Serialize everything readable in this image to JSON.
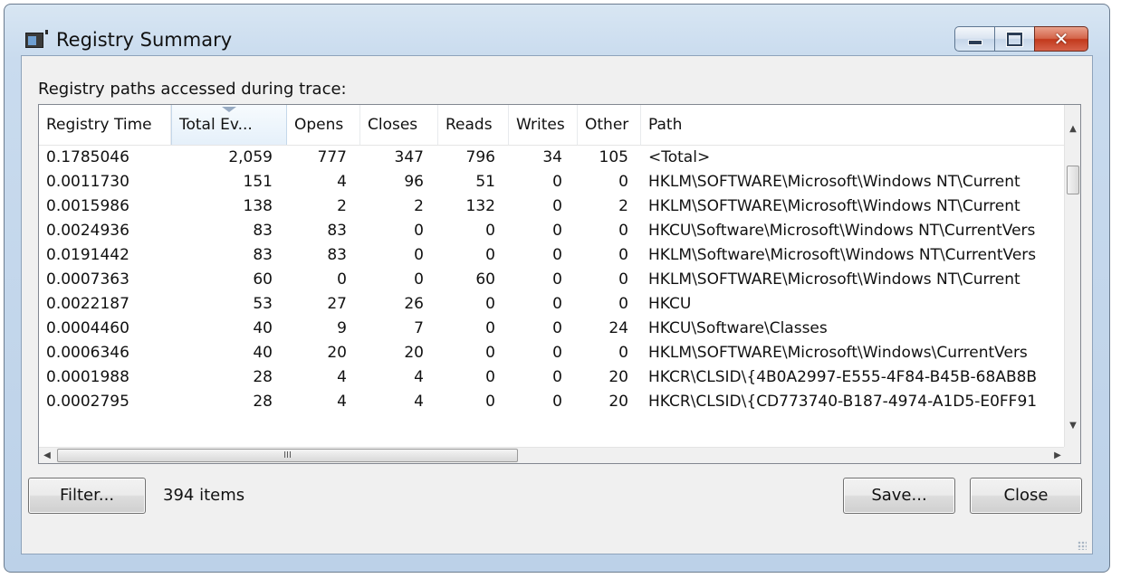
{
  "window": {
    "title": "Registry Summary",
    "icon": "app-window-icon",
    "min_glyph": "minimize-icon",
    "max_glyph": "maximize-icon",
    "close_glyph": "✕"
  },
  "caption_label": "Registry paths accessed during trace:",
  "columns": [
    "Registry Time",
    "Total Ev...",
    "Opens",
    "Closes",
    "Reads",
    "Writes",
    "Other",
    "Path"
  ],
  "sorted_column": "Total Ev...",
  "rows": [
    {
      "time": "0.1785046",
      "total": "2,059",
      "opens": "777",
      "closes": "347",
      "reads": "796",
      "writes": "34",
      "other": "105",
      "path": "<Total>"
    },
    {
      "time": "0.0011730",
      "total": "151",
      "opens": "4",
      "closes": "96",
      "reads": "51",
      "writes": "0",
      "other": "0",
      "path": "HKLM\\SOFTWARE\\Microsoft\\Windows NT\\Current"
    },
    {
      "time": "0.0015986",
      "total": "138",
      "opens": "2",
      "closes": "2",
      "reads": "132",
      "writes": "0",
      "other": "2",
      "path": "HKLM\\SOFTWARE\\Microsoft\\Windows NT\\Current"
    },
    {
      "time": "0.0024936",
      "total": "83",
      "opens": "83",
      "closes": "0",
      "reads": "0",
      "writes": "0",
      "other": "0",
      "path": "HKCU\\Software\\Microsoft\\Windows NT\\CurrentVers"
    },
    {
      "time": "0.0191442",
      "total": "83",
      "opens": "83",
      "closes": "0",
      "reads": "0",
      "writes": "0",
      "other": "0",
      "path": "HKLM\\Software\\Microsoft\\Windows NT\\CurrentVers"
    },
    {
      "time": "0.0007363",
      "total": "60",
      "opens": "0",
      "closes": "0",
      "reads": "60",
      "writes": "0",
      "other": "0",
      "path": "HKLM\\SOFTWARE\\Microsoft\\Windows NT\\Current"
    },
    {
      "time": "0.0022187",
      "total": "53",
      "opens": "27",
      "closes": "26",
      "reads": "0",
      "writes": "0",
      "other": "0",
      "path": "HKCU"
    },
    {
      "time": "0.0004460",
      "total": "40",
      "opens": "9",
      "closes": "7",
      "reads": "0",
      "writes": "0",
      "other": "24",
      "path": "HKCU\\Software\\Classes"
    },
    {
      "time": "0.0006346",
      "total": "40",
      "opens": "20",
      "closes": "20",
      "reads": "0",
      "writes": "0",
      "other": "0",
      "path": "HKLM\\SOFTWARE\\Microsoft\\Windows\\CurrentVers"
    },
    {
      "time": "0.0001988",
      "total": "28",
      "opens": "4",
      "closes": "4",
      "reads": "0",
      "writes": "0",
      "other": "20",
      "path": "HKCR\\CLSID\\{4B0A2997-E555-4F84-B45B-68AB8B"
    },
    {
      "time": "0.0002795",
      "total": "28",
      "opens": "4",
      "closes": "4",
      "reads": "0",
      "writes": "0",
      "other": "20",
      "path": "HKCR\\CLSID\\{CD773740-B187-4974-A1D5-E0FF91"
    }
  ],
  "scrollbar": {
    "h_thumb_grip": "III",
    "up_arrow": "▲",
    "down_arrow": "▼",
    "left_arrow": "◀",
    "right_arrow": "▶"
  },
  "buttons": {
    "filter": "Filter...",
    "save": "Save...",
    "close": "Close"
  },
  "status": "394 items"
}
